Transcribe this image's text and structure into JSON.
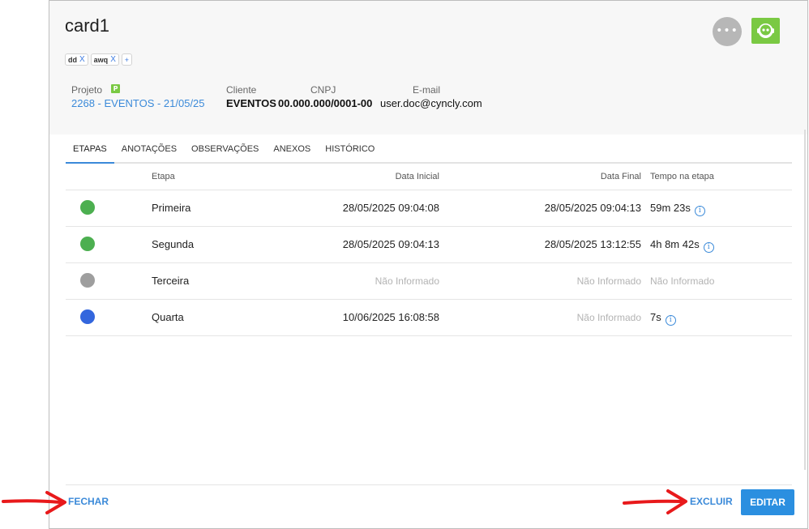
{
  "card": {
    "title": "card1",
    "more_label": "•••",
    "tags": [
      {
        "label": "dd",
        "remove": "X"
      },
      {
        "label": "awq",
        "remove": "X"
      }
    ],
    "add_tag": "+"
  },
  "info": {
    "project_label": "Projeto",
    "project_badge": "P",
    "project_value": "2268 - EVENTOS - 21/05/25",
    "client_label": "Cliente",
    "client_value": "EVENTOS",
    "cnpj_label": "CNPJ",
    "cnpj_value": "00.000.000/0001-00",
    "email_label": "E-mail",
    "email_value": "user.doc@cyncly.com"
  },
  "tabs": [
    {
      "label": "ETAPAS",
      "active": true
    },
    {
      "label": "ANOTAÇÕES",
      "active": false
    },
    {
      "label": "OBSERVAÇÕES",
      "active": false
    },
    {
      "label": "ANEXOS",
      "active": false
    },
    {
      "label": "HISTÓRICO",
      "active": false
    }
  ],
  "table": {
    "headers": {
      "stage": "Etapa",
      "start": "Data Inicial",
      "end": "Data Final",
      "time": "Tempo na etapa"
    },
    "rows": [
      {
        "color": "#4caf50",
        "stage": "Primeira",
        "start": "28/05/2025 09:04:08",
        "end": "28/05/2025 09:04:13",
        "time": "59m 23s",
        "info": "i"
      },
      {
        "color": "#4caf50",
        "stage": "Segunda",
        "start": "28/05/2025 09:04:13",
        "end": "28/05/2025 13:12:55",
        "time": "4h 8m 42s",
        "info": "i"
      },
      {
        "color": "#9e9e9e",
        "stage": "Terceira",
        "start": "Não Informado",
        "end": "Não Informado",
        "time": "Não Informado",
        "info": ""
      },
      {
        "color": "#3366dd",
        "stage": "Quarta",
        "start": "10/06/2025 16:08:58",
        "end": "Não Informado",
        "time": "7s",
        "info": "i"
      }
    ]
  },
  "footer": {
    "close_label": "FECHAR",
    "delete_label": "EXCLUIR",
    "edit_label": "EDITAR"
  },
  "colors": {
    "accent": "#3b8ad9",
    "primary_button": "#2b8fe0",
    "green": "#7ac943",
    "arrow": "#e8191b"
  }
}
